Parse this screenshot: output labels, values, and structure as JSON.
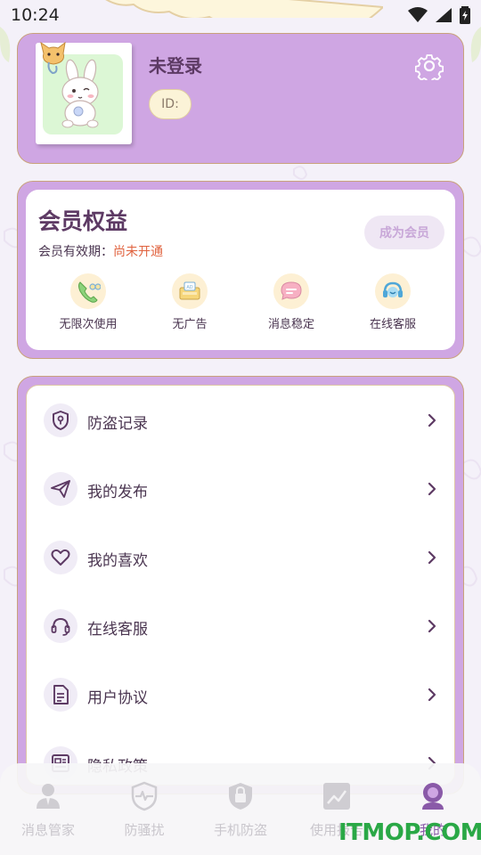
{
  "status_bar": {
    "time": "10:24"
  },
  "profile": {
    "name": "未登录",
    "id_label": "ID:"
  },
  "membership": {
    "title": "会员权益",
    "validity_label": "会员有效期：",
    "validity_status": "尚未开通",
    "join_button": "成为会员",
    "benefits": [
      {
        "label": "无限次使用",
        "icon": "phone-icon"
      },
      {
        "label": "无广告",
        "icon": "ad-free-icon"
      },
      {
        "label": "消息稳定",
        "icon": "message-icon"
      },
      {
        "label": "在线客服",
        "icon": "headset-icon"
      }
    ]
  },
  "menu": [
    {
      "label": "防盗记录",
      "icon": "shield-icon"
    },
    {
      "label": "我的发布",
      "icon": "paper-plane-icon"
    },
    {
      "label": "我的喜欢",
      "icon": "heart-icon"
    },
    {
      "label": "在线客服",
      "icon": "headset-icon"
    },
    {
      "label": "用户协议",
      "icon": "document-icon"
    },
    {
      "label": "隐私政策",
      "icon": "id-card-icon"
    }
  ],
  "bottom_nav": [
    {
      "label": "消息管家",
      "icon": "user-icon"
    },
    {
      "label": "防骚扰",
      "icon": "shield-pulse-icon"
    },
    {
      "label": "手机防盗",
      "icon": "lock-shield-icon"
    },
    {
      "label": "使用报告",
      "icon": "chart-icon"
    },
    {
      "label": "我的",
      "icon": "profile-icon",
      "active": true
    }
  ],
  "watermark": "ITMOP.COM",
  "colors": {
    "accent": "#cfa6e3",
    "title": "#5d3a64",
    "warning": "#e0623e"
  }
}
